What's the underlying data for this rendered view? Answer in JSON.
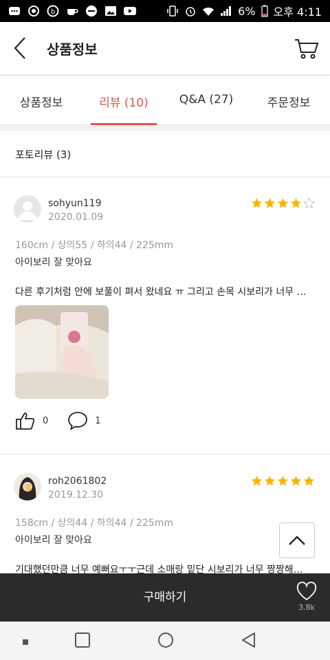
{
  "status_bar": {
    "battery": "6%",
    "time": "오후 4:11"
  },
  "app_bar": {
    "title": "상품정보",
    "back_icon": "chevron-left-icon",
    "cart_icon": "cart-icon"
  },
  "tabs": [
    {
      "label": "상품정보",
      "active": false
    },
    {
      "label": "리뷰 (10)",
      "active": true
    },
    {
      "label": "Q&A (27)",
      "active": false
    },
    {
      "label": "주문정보",
      "active": false
    }
  ],
  "section_title": "포토리뷰 (3)",
  "reviews": [
    {
      "username": "sohyun119",
      "date": "2020.01.09",
      "rating": 4,
      "body_info": "160cm / 상의55 / 하의44 / 225mm",
      "option": "아이보리 잘 맞아요",
      "content": "다른 후기처럼 안에 보풀이 펴서 왔네요 ㅠ 그리고 손목 시보리가 너무 짱짱해서",
      "likes": "0",
      "comments": "1"
    },
    {
      "username": "roh2061802",
      "date": "2019.12.30",
      "rating": 5,
      "body_info": "158cm / 상의44 / 하의44 / 225mm",
      "option": "아이보리 잘 맞아요",
      "content": "기대했던만큼 너무 예뻐요ㅜㅜ근데 소매랑 밑단 시보리가 너무 짱짱해서 불편해요"
    }
  ],
  "buy_bar": {
    "buy_label": "구매하기",
    "like_count": "3.8k"
  },
  "colors": {
    "accent": "#e8514a",
    "star": "#f5b800",
    "buy_bar": "#2b2b2b"
  }
}
